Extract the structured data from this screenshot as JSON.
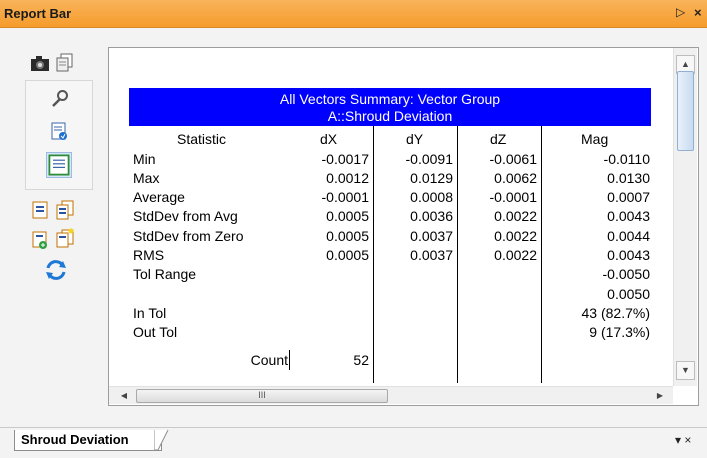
{
  "window": {
    "title": "Report Bar",
    "pin_glyph": "▷",
    "close_glyph": "×"
  },
  "toolbar": {
    "buttons": [
      {
        "name": "camera-icon"
      },
      {
        "name": "copy-icon"
      },
      {
        "name": "wrench-icon"
      },
      {
        "name": "report-template-icon"
      },
      {
        "name": "report-layout-icon"
      },
      {
        "name": "single-page-icon"
      },
      {
        "name": "multi-page-icon"
      },
      {
        "name": "add-page-icon"
      },
      {
        "name": "new-pages-icon"
      },
      {
        "name": "refresh-icon"
      }
    ]
  },
  "report": {
    "header_line1": "All Vectors Summary: Vector Group",
    "header_line2": "A::Shroud Deviation",
    "columns": [
      "Statistic",
      "dX",
      "dY",
      "dZ",
      "Mag"
    ],
    "rows": [
      {
        "label": "Min",
        "dx": "-0.0017",
        "dy": "-0.0091",
        "dz": "-0.0061",
        "mag": "-0.0110"
      },
      {
        "label": "Max",
        "dx": "0.0012",
        "dy": "0.0129",
        "dz": "0.0062",
        "mag": "0.0130"
      },
      {
        "label": "Average",
        "dx": "-0.0001",
        "dy": "0.0008",
        "dz": "-0.0001",
        "mag": "0.0007"
      },
      {
        "label": "StdDev from Avg",
        "dx": "0.0005",
        "dy": "0.0036",
        "dz": "0.0022",
        "mag": "0.0043"
      },
      {
        "label": "StdDev from Zero",
        "dx": "0.0005",
        "dy": "0.0037",
        "dz": "0.0022",
        "mag": "0.0044"
      },
      {
        "label": "RMS",
        "dx": "0.0005",
        "dy": "0.0037",
        "dz": "0.0022",
        "mag": "0.0043"
      }
    ],
    "tol_range_label": "Tol Range",
    "tol_range_low": "-0.0050",
    "tol_range_high": "0.0050",
    "in_tol_label": "In Tol",
    "in_tol_value": "43 (82.7%)",
    "out_tol_label": "Out Tol",
    "out_tol_value": "9 (17.3%)",
    "count_label": "Count",
    "count_value": "52"
  },
  "scrollbars": {
    "h_thumb_grip": "III"
  },
  "tabs": {
    "active": "Shroud Deviation",
    "controls_glyph": "▾ ×"
  },
  "colors": {
    "title_bar": "#f59c2c",
    "report_header": "#0000ff"
  }
}
